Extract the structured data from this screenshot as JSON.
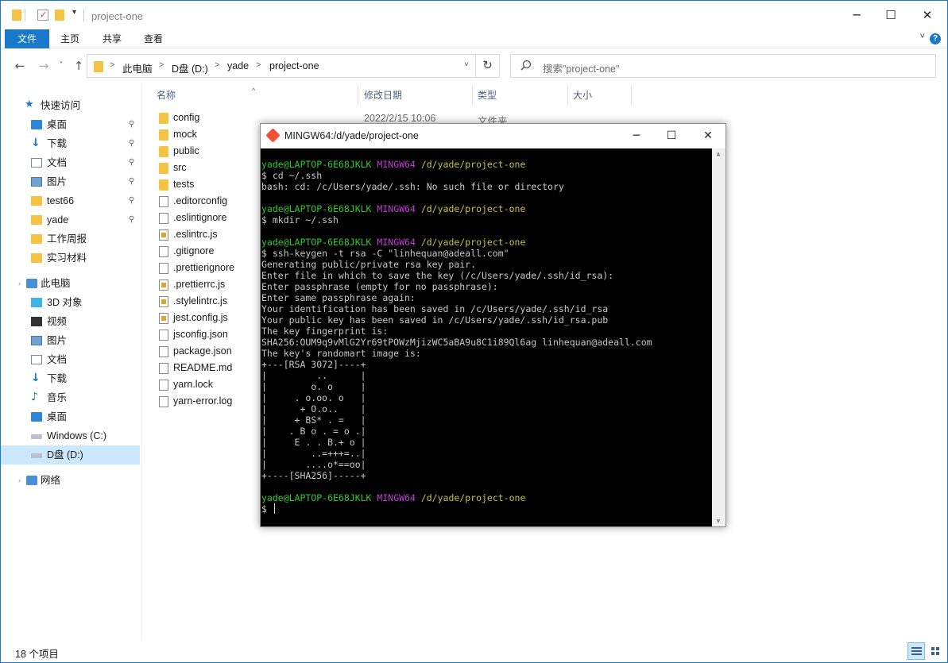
{
  "titlebar": {
    "title": "project-one",
    "minimize": "─",
    "maximize": "☐",
    "close": "✕"
  },
  "ribbon": {
    "tabs": [
      "文件",
      "主页",
      "共享",
      "查看"
    ],
    "collapse": "˅",
    "help": "?"
  },
  "address": {
    "back": "←",
    "forward": "→",
    "recent": "˅",
    "up": "↑",
    "crumbs": [
      "此电脑",
      "D盘 (D:)",
      "yade",
      "project-one"
    ],
    "separator": ">",
    "dropdown": "˅",
    "refresh": "↻"
  },
  "search": {
    "placeholder": "搜索\"project-one\"",
    "icon": "search-icon"
  },
  "sidebar": {
    "quick_access": "快速访问",
    "quick_items": [
      {
        "label": "桌面",
        "icon": "desktop-icon"
      },
      {
        "label": "下载",
        "icon": "download-icon"
      },
      {
        "label": "文档",
        "icon": "document-icon"
      },
      {
        "label": "图片",
        "icon": "picture-icon"
      },
      {
        "label": "test66",
        "icon": "folder-icon"
      },
      {
        "label": "yade",
        "icon": "folder-icon"
      },
      {
        "label": "工作周报",
        "icon": "folder-icon"
      },
      {
        "label": "实习材料",
        "icon": "folder-icon"
      }
    ],
    "this_pc": "此电脑",
    "pc_items": [
      {
        "label": "3D 对象",
        "icon": "3d-objects-icon"
      },
      {
        "label": "视频",
        "icon": "video-icon"
      },
      {
        "label": "图片",
        "icon": "picture-icon"
      },
      {
        "label": "文档",
        "icon": "document-icon"
      },
      {
        "label": "下载",
        "icon": "download-icon"
      },
      {
        "label": "音乐",
        "icon": "music-icon"
      },
      {
        "label": "桌面",
        "icon": "desktop-icon"
      },
      {
        "label": "Windows (C:)",
        "icon": "drive-icon"
      },
      {
        "label": "D盘 (D:)",
        "icon": "drive-icon"
      }
    ],
    "network": "网络",
    "pin": "📌"
  },
  "columns": {
    "name": "名称",
    "modified": "修改日期",
    "type": "类型",
    "size": "大小",
    "sort_indicator": "^"
  },
  "files": [
    {
      "name": "config",
      "kind": "folder"
    },
    {
      "name": "mock",
      "kind": "folder"
    },
    {
      "name": "public",
      "kind": "folder"
    },
    {
      "name": "src",
      "kind": "folder"
    },
    {
      "name": "tests",
      "kind": "folder"
    },
    {
      "name": ".editorconfig",
      "kind": "file"
    },
    {
      "name": ".eslintignore",
      "kind": "file"
    },
    {
      "name": ".eslintrc.js",
      "kind": "js"
    },
    {
      "name": ".gitignore",
      "kind": "file"
    },
    {
      "name": ".prettierignore",
      "kind": "file"
    },
    {
      "name": ".prettierrc.js",
      "kind": "js"
    },
    {
      "name": ".stylelintrc.js",
      "kind": "js"
    },
    {
      "name": "jest.config.js",
      "kind": "js"
    },
    {
      "name": "jsconfig.json",
      "kind": "file"
    },
    {
      "name": "package.json",
      "kind": "file"
    },
    {
      "name": "README.md",
      "kind": "file"
    },
    {
      "name": "yarn.lock",
      "kind": "file"
    },
    {
      "name": "yarn-error.log",
      "kind": "file"
    }
  ],
  "first_row": {
    "modified": "2022/2/15 10:06",
    "type": "文件夹"
  },
  "status": {
    "count": "18 个项目"
  },
  "terminal": {
    "title": "MINGW64:/d/yade/project-one",
    "minimize": "─",
    "maximize": "☐",
    "close": "✕",
    "prompt_user": "yade@LAPTOP-6E68JKLK",
    "prompt_sys": "MINGW64",
    "prompt_path": "/d/yade/project-one",
    "lines": [
      {
        "kind": "prompt"
      },
      {
        "kind": "text",
        "text": "$ cd ~/.ssh"
      },
      {
        "kind": "text",
        "text": "bash: cd: /c/Users/yade/.ssh: No such file or directory"
      },
      {
        "kind": "text",
        "text": ""
      },
      {
        "kind": "prompt"
      },
      {
        "kind": "text",
        "text": "$ mkdir ~/.ssh"
      },
      {
        "kind": "text",
        "text": ""
      },
      {
        "kind": "prompt"
      },
      {
        "kind": "text",
        "text": "$ ssh-keygen -t rsa -C \"linhequan@adeall.com\""
      },
      {
        "kind": "text",
        "text": "Generating public/private rsa key pair."
      },
      {
        "kind": "text",
        "text": "Enter file in which to save the key (/c/Users/yade/.ssh/id_rsa):"
      },
      {
        "kind": "text",
        "text": "Enter passphrase (empty for no passphrase):"
      },
      {
        "kind": "text",
        "text": "Enter same passphrase again:"
      },
      {
        "kind": "text",
        "text": "Your identification has been saved in /c/Users/yade/.ssh/id_rsa"
      },
      {
        "kind": "text",
        "text": "Your public key has been saved in /c/Users/yade/.ssh/id_rsa.pub"
      },
      {
        "kind": "text",
        "text": "The key fingerprint is:"
      },
      {
        "kind": "text",
        "text": "SHA256:OUM9q9vMlG2Yr69tPOWzMjizWC5aBA9u8C1i89Ql6ag linhequan@adeall.com"
      },
      {
        "kind": "text",
        "text": "The key's randomart image is:"
      },
      {
        "kind": "text",
        "text": "+---[RSA 3072]----+"
      },
      {
        "kind": "text",
        "text": "|         ..      |"
      },
      {
        "kind": "text",
        "text": "|        o. o     |"
      },
      {
        "kind": "text",
        "text": "|     . o.oo. o   |"
      },
      {
        "kind": "text",
        "text": "|      + O.o..    |"
      },
      {
        "kind": "text",
        "text": "|     + BS* . =   |"
      },
      {
        "kind": "text",
        "text": "|    . B o . = o .|"
      },
      {
        "kind": "text",
        "text": "|     E . . B.+ o |"
      },
      {
        "kind": "text",
        "text": "|        ..=+++=..|"
      },
      {
        "kind": "text",
        "text": "|       ....o*==oo|"
      },
      {
        "kind": "text",
        "text": "+----[SHA256]-----+"
      },
      {
        "kind": "text",
        "text": ""
      },
      {
        "kind": "prompt"
      },
      {
        "kind": "cursor",
        "text": "$ "
      }
    ]
  }
}
